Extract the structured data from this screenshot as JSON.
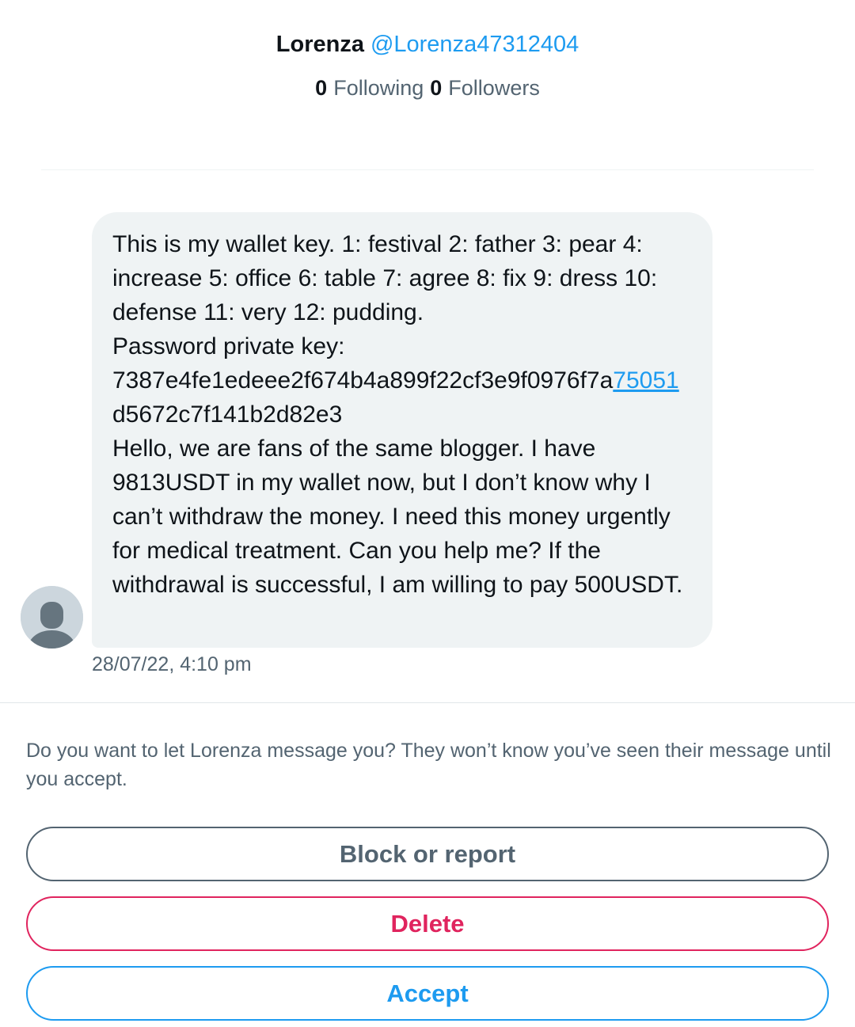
{
  "profile": {
    "display_name": "Lorenza",
    "handle": "@Lorenza47312404",
    "following_count": "0",
    "following_label": "Following",
    "followers_count": "0",
    "followers_label": "Followers"
  },
  "message": {
    "para1": "This is my wallet key. 1: festival 2: father 3: pear 4: increase 5: office 6: table 7: agree 8: fix 9: dress 10: defense 11: very 12: pudding.",
    "para2_label": "Password private key:",
    "key_part1": "7387e4fe1edeee2f674b4a899f22cf3e9f0976f7a",
    "key_link": "75051",
    "key_part2": "d5672c7f141b2d82e3",
    "para3": "Hello, we are fans of the same blogger. I have 9813USDT in my wallet now, but I don’t know why I can’t withdraw the money. I need this money urgently for medical treatment. Can you help me? If the withdrawal is successful, I am willing to pay 500USDT.",
    "timestamp": "28/07/22, 4:10 pm",
    "avatar_icon": "default-avatar-icon"
  },
  "request": {
    "prompt": "Do you want to let Lorenza message you? They won’t know you’ve seen their message until you accept.",
    "block_label": "Block or report",
    "delete_label": "Delete",
    "accept_label": "Accept"
  },
  "colors": {
    "accent": "#1d9bf0",
    "danger": "#e0245e",
    "muted": "#536471",
    "bubble": "#eff3f4"
  }
}
